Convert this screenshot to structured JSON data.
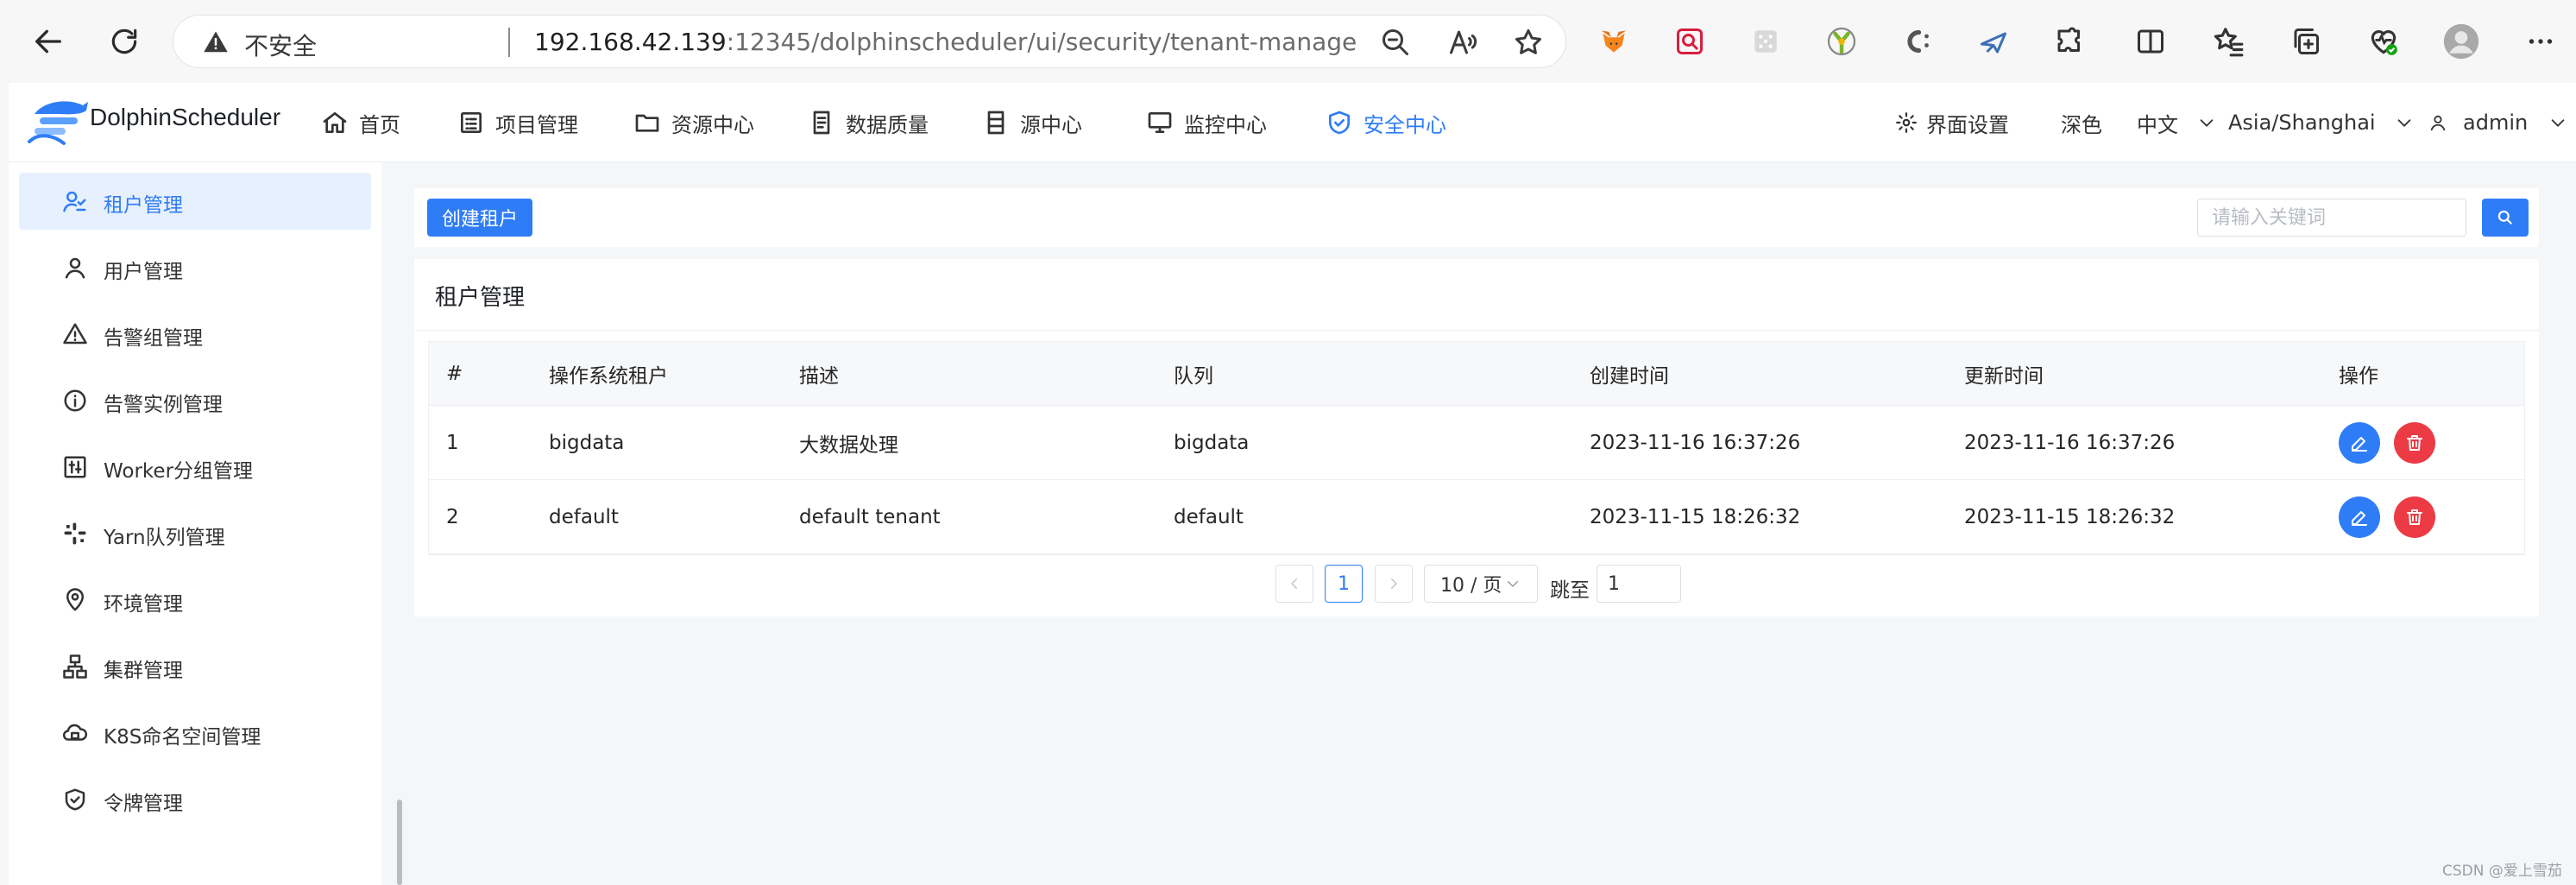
{
  "browser": {
    "insecure_label": "不安全",
    "url_host": "192.168.42.139",
    "url_path": ":12345/dolphinscheduler/ui/security/tenant-manage"
  },
  "header": {
    "brand": "DolphinScheduler",
    "nav": [
      {
        "label": "首页",
        "icon": "home-icon"
      },
      {
        "label": "项目管理",
        "icon": "project-list-icon"
      },
      {
        "label": "资源中心",
        "icon": "folder-icon"
      },
      {
        "label": "数据质量",
        "icon": "quality-doc-icon"
      },
      {
        "label": "源中心",
        "icon": "datasource-icon"
      },
      {
        "label": "监控中心",
        "icon": "monitor-icon"
      },
      {
        "label": "安全中心",
        "icon": "shield-check-icon",
        "active": true
      }
    ],
    "ui_settings": "界面设置",
    "theme": "深色",
    "language": "中文",
    "timezone": "Asia/Shanghai",
    "user": "admin"
  },
  "sidebar": {
    "items": [
      {
        "label": "租户管理",
        "icon": "tenant-icon",
        "active": true
      },
      {
        "label": "用户管理",
        "icon": "user-icon"
      },
      {
        "label": "告警组管理",
        "icon": "warning-triangle-icon"
      },
      {
        "label": "告警实例管理",
        "icon": "info-circle-icon"
      },
      {
        "label": "Worker分组管理",
        "icon": "worker-group-icon"
      },
      {
        "label": "Yarn队列管理",
        "icon": "yarn-queue-icon"
      },
      {
        "label": "环境管理",
        "icon": "location-icon"
      },
      {
        "label": "集群管理",
        "icon": "cluster-icon"
      },
      {
        "label": "K8S命名空间管理",
        "icon": "k8s-namespace-icon"
      },
      {
        "label": "令牌管理",
        "icon": "token-shield-icon"
      }
    ]
  },
  "toolbar": {
    "create_label": "创建租户",
    "search_placeholder": "请输入关键词"
  },
  "card": {
    "title": "租户管理"
  },
  "table": {
    "columns": [
      "#",
      "操作系统租户",
      "描述",
      "队列",
      "创建时间",
      "更新时间",
      "操作"
    ],
    "rows": [
      {
        "index": "1",
        "tenant": "bigdata",
        "desc": "大数据处理",
        "queue": "bigdata",
        "created": "2023-11-16 16:37:26",
        "updated": "2023-11-16 16:37:26"
      },
      {
        "index": "2",
        "tenant": "default",
        "desc": "default tenant",
        "queue": "default",
        "created": "2023-11-15 18:26:32",
        "updated": "2023-11-15 18:26:32"
      }
    ]
  },
  "pagination": {
    "current_page": "1",
    "page_size": "10 / 页",
    "jump_label": "跳至",
    "jump_value": "1"
  },
  "watermark": "CSDN @爱上雪茄",
  "colors": {
    "accent": "#2f7df6",
    "danger": "#ec3b45",
    "active_bg": "#e7f0fe"
  }
}
